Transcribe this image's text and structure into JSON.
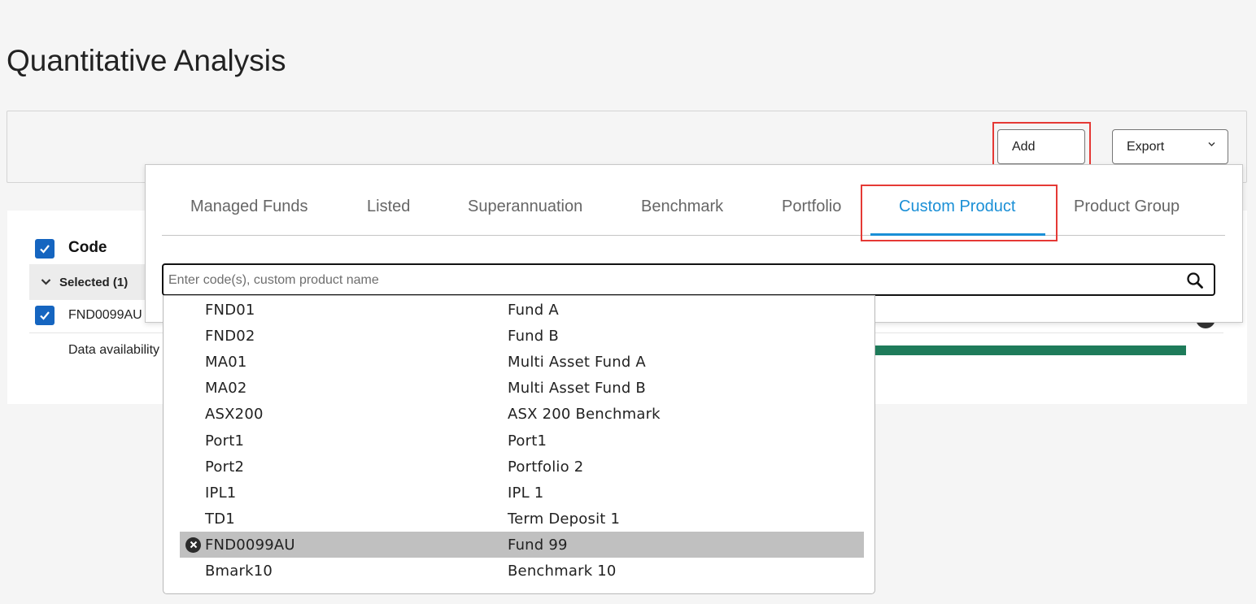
{
  "page": {
    "title": "Quantitative Analysis"
  },
  "toolbar": {
    "add_label": "Add",
    "export_label": "Export"
  },
  "table": {
    "header_code": "Code",
    "selected_group": "Selected (1)",
    "row_code": "FND0099AU",
    "data_availability_label": "Data availability"
  },
  "add_panel": {
    "tabs": [
      {
        "label": "Managed Funds"
      },
      {
        "label": "Listed"
      },
      {
        "label": "Superannuation"
      },
      {
        "label": "Benchmark"
      },
      {
        "label": "Portfolio"
      },
      {
        "label": "Custom Product"
      },
      {
        "label": "Product Group"
      }
    ],
    "active_tab": "Custom Product",
    "search": {
      "placeholder": "Enter code(s), custom product name",
      "value": ""
    },
    "results": [
      {
        "code": "FND01",
        "name": "Fund A"
      },
      {
        "code": "FND02",
        "name": "Fund B"
      },
      {
        "code": "MA01",
        "name": "Multi Asset Fund A"
      },
      {
        "code": "MA02",
        "name": "Multi Asset Fund B"
      },
      {
        "code": "ASX200",
        "name": "ASX 200 Benchmark"
      },
      {
        "code": "Port1",
        "name": "Port1"
      },
      {
        "code": "Port2",
        "name": "Portfolio 2"
      },
      {
        "code": "IPL1",
        "name": "IPL 1"
      },
      {
        "code": "TD1",
        "name": "Term Deposit 1"
      },
      {
        "code": "FND0099AU",
        "name": "Fund 99"
      },
      {
        "code": "Bmark10",
        "name": "Benchmark 10"
      }
    ],
    "selected_result": "FND0099AU"
  },
  "colors": {
    "accent": "#1a8fd6",
    "checkbox": "#1565c0",
    "highlight_box": "#e53935",
    "availability_bar": "#1e7b5a",
    "selected_row": "#c0c0c0"
  }
}
